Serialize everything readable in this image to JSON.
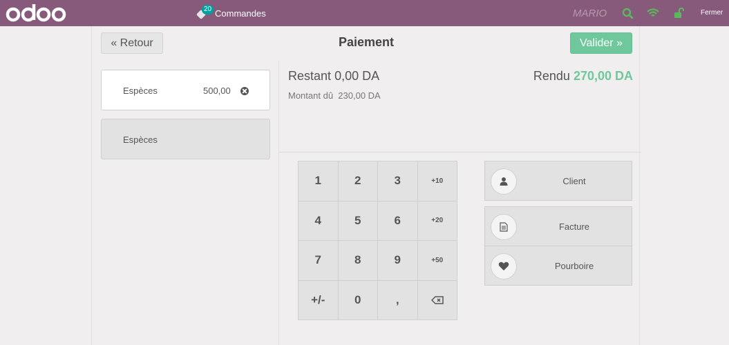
{
  "topbar": {
    "logo_text": "odoo",
    "orders_count": "20",
    "orders_label": "Commandes",
    "cashier": "MARIO",
    "close_label": "Fermer",
    "icons": [
      "search-icon",
      "wifi-icon",
      "unlock-icon"
    ],
    "colors": {
      "bar": "#875a7b",
      "icon_green": "#5cb85c",
      "badge": "#00a09d"
    }
  },
  "header": {
    "back_label": "« Retour",
    "title": "Paiement",
    "validate_label": "Valider »"
  },
  "paymentlines": [
    {
      "method": "Espèces",
      "amount": "500,00"
    }
  ],
  "paymentmethods": [
    {
      "label": "Espèces"
    }
  ],
  "summary": {
    "remaining_label": "Restant",
    "remaining_value": "0,00 DA",
    "due_label": "Montant dû",
    "due_value": "230,00 DA",
    "change_label": "Rendu",
    "change_value": "270,00 DA"
  },
  "numpad": {
    "keys": [
      "1",
      "2",
      "3",
      "+10",
      "4",
      "5",
      "6",
      "+20",
      "7",
      "8",
      "9",
      "+50",
      "+/-",
      "0",
      ","
    ]
  },
  "actions": {
    "client_label": "Client",
    "invoice_label": "Facture",
    "tip_label": "Pourboire"
  },
  "colors": {
    "accent_green": "#6ec89b",
    "validate_bg": "#6ec89b"
  }
}
